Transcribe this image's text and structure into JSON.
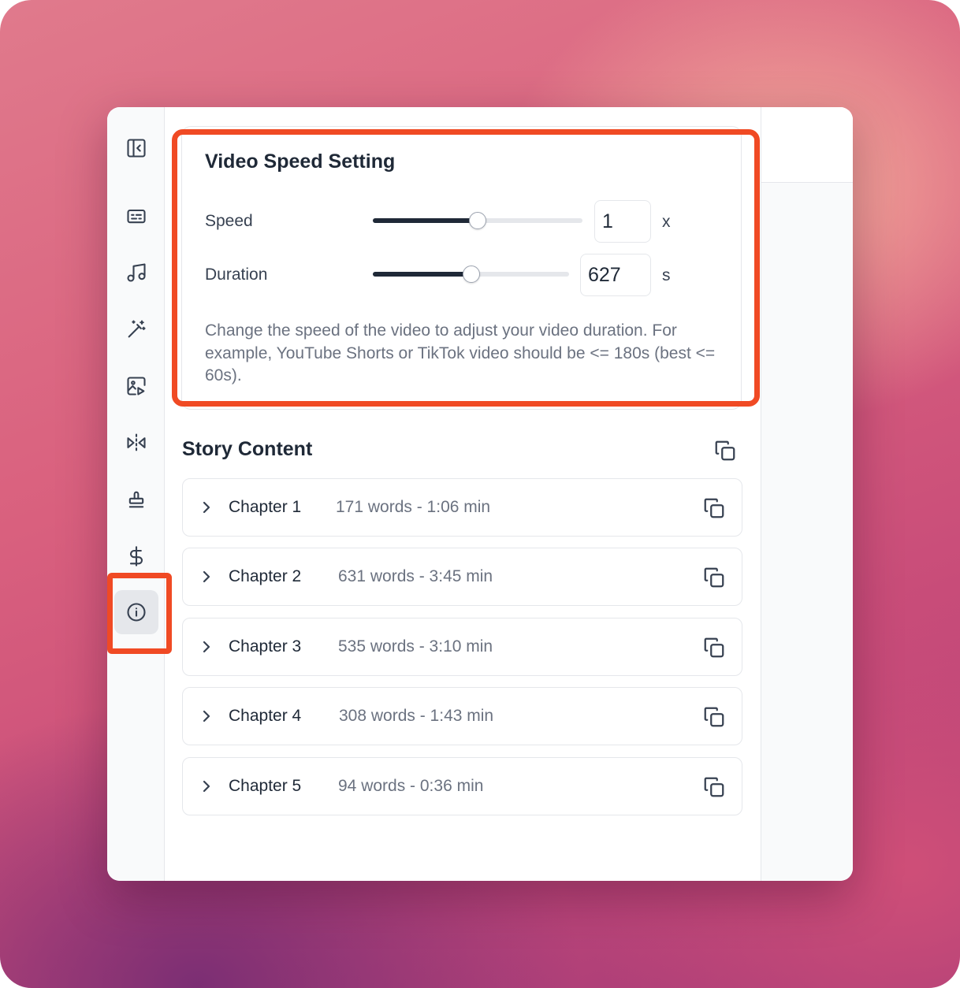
{
  "sidebar": {
    "items": [
      {
        "icon": "panel-collapse-icon"
      },
      {
        "icon": "subtitles-icon"
      },
      {
        "icon": "music-note-icon"
      },
      {
        "icon": "magic-wand-icon"
      },
      {
        "icon": "image-video-icon"
      },
      {
        "icon": "flip-horizontal-icon"
      },
      {
        "icon": "stamp-icon"
      },
      {
        "icon": "dollar-icon"
      },
      {
        "icon": "info-icon",
        "active": true
      }
    ]
  },
  "speed_setting": {
    "title": "Video Speed Setting",
    "speed": {
      "label": "Speed",
      "value": "1",
      "unit": "x",
      "slider_fraction": 0.5
    },
    "duration": {
      "label": "Duration",
      "value": "627",
      "unit": "s",
      "slider_fraction": 0.5
    },
    "help_text": "Change the speed of the video to adjust your video duration. For example, YouTube Shorts or TikTok video should be <= 180s (best <= 60s)."
  },
  "story": {
    "title": "Story Content",
    "chapters": [
      {
        "title": "Chapter 1",
        "meta": "171 words - 1:06 min"
      },
      {
        "title": "Chapter 2",
        "meta": "631 words - 3:45 min"
      },
      {
        "title": "Chapter 3",
        "meta": "535 words - 3:10 min"
      },
      {
        "title": "Chapter 4",
        "meta": "308 words - 1:43 min"
      },
      {
        "title": "Chapter 5",
        "meta": "94 words - 0:36 min"
      }
    ]
  },
  "colors": {
    "highlight": "#f04a24",
    "slider_fill": "#1f2937",
    "slider_track": "#e5e7eb"
  }
}
